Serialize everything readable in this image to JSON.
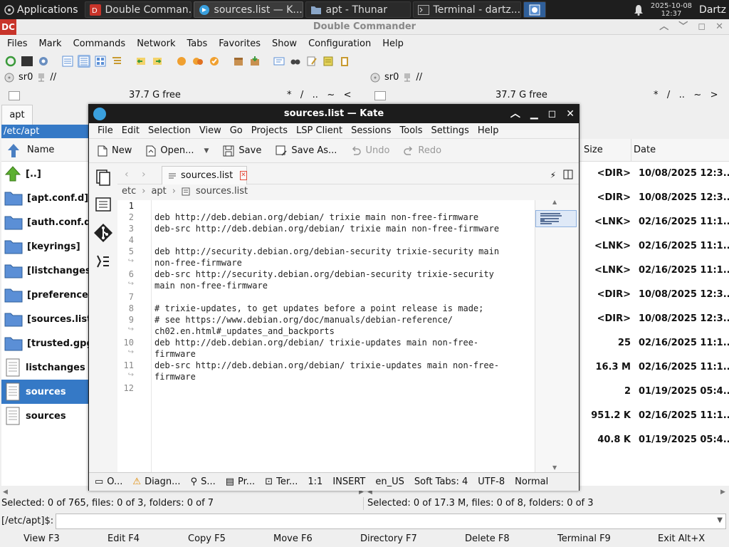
{
  "taskbar": {
    "apps_label": "Applications",
    "tasks": [
      {
        "label": "Double Comman...",
        "icon": "doublecmd-icon"
      },
      {
        "label": "sources.list  — K...",
        "icon": "kate-icon"
      },
      {
        "label": "apt - Thunar",
        "icon": "folder-icon"
      },
      {
        "label": "Terminal - dartz...",
        "icon": "terminal-icon"
      }
    ],
    "clock_date": "2025-10-08",
    "clock_time": "12:37",
    "user": "Dartz"
  },
  "dc": {
    "title": "Double Commander",
    "menu": [
      "Files",
      "Mark",
      "Commands",
      "Network",
      "Tabs",
      "Favorites",
      "Show",
      "Configuration",
      "Help"
    ],
    "drive_left": "sr0",
    "drive_left_path": "//",
    "drive_right": "sr0",
    "drive_right_path": "//",
    "free_left": "37.7 G free",
    "free_right": "37.7 G free",
    "nav_left": "*   /   ..   ~   <",
    "nav_right": "*   /   ..   ~   >",
    "tab_left": "apt",
    "path_left": "/etc/apt",
    "col_name": "Name",
    "col_size": "Size",
    "col_date": "Date",
    "files_left": [
      "[..]",
      "[apt.conf.d]",
      "[auth.conf.d]",
      "[keyrings]",
      "[listchanges...",
      "[preferences...",
      "[sources.list...",
      "[trusted.gpg...",
      "listchanges",
      "sources",
      "sources"
    ],
    "files_right": [
      {
        "size": "<DIR>",
        "date": "10/08/2025 12:3..."
      },
      {
        "size": "<DIR>",
        "date": "10/08/2025 12:3..."
      },
      {
        "size": "<LNK>",
        "date": "02/16/2025 11:1..."
      },
      {
        "size": "<LNK>",
        "date": "02/16/2025 11:1..."
      },
      {
        "size": "<LNK>",
        "date": "02/16/2025 11:1..."
      },
      {
        "size": "<DIR>",
        "date": "10/08/2025 12:3..."
      },
      {
        "size": "<DIR>",
        "date": "10/08/2025 12:3..."
      },
      {
        "size": "25",
        "date": "02/16/2025 11:1..."
      },
      {
        "size": "16.3 M",
        "date": "02/16/2025 11:1..."
      },
      {
        "size": "2",
        "date": "01/19/2025 05:4..."
      },
      {
        "size": "951.2 K",
        "date": "02/16/2025 11:1..."
      },
      {
        "size": "40.8 K",
        "date": "01/19/2025 05:4..."
      }
    ],
    "status_left": "Selected: 0 of 765, files: 0 of 3, folders: 0 of 7",
    "status_right": "Selected: 0 of 17.3 M, files: 0 of 8, folders: 0 of 3",
    "cmd_prompt": "[/etc/apt]$:",
    "fkeys": [
      "View F3",
      "Edit F4",
      "Copy F5",
      "Move F6",
      "Directory F7",
      "Delete F8",
      "Terminal F9",
      "Exit Alt+X"
    ]
  },
  "kate": {
    "title": "sources.list  — Kate",
    "menu": [
      "File",
      "Edit",
      "Selection",
      "View",
      "Go",
      "Projects",
      "LSP Client",
      "Sessions",
      "Tools",
      "Settings",
      "Help"
    ],
    "tool_new": "New",
    "tool_open": "Open...",
    "tool_save": "Save",
    "tool_saveas": "Save As...",
    "tool_undo": "Undo",
    "tool_redo": "Redo",
    "tab_name": "sources.list",
    "bread_1": "etc",
    "bread_2": "apt",
    "bread_3": "sources.list",
    "lines": [
      {
        "n": "1",
        "text": ""
      },
      {
        "n": "2",
        "text": "deb http://deb.debian.org/debian/ trixie main non-free-firmware"
      },
      {
        "n": "3",
        "text": "deb-src http://deb.debian.org/debian/ trixie main non-free-firmware"
      },
      {
        "n": "4",
        "text": ""
      },
      {
        "n": "5",
        "text": "deb http://security.debian.org/debian-security trixie-security main"
      },
      {
        "n": "",
        "text": "non-free-firmware"
      },
      {
        "n": "6",
        "text": "deb-src http://security.debian.org/debian-security trixie-security"
      },
      {
        "n": "",
        "text": "main non-free-firmware"
      },
      {
        "n": "7",
        "text": ""
      },
      {
        "n": "8",
        "text": "# trixie-updates, to get updates before a point release is made;"
      },
      {
        "n": "9",
        "text": "# see https://www.debian.org/doc/manuals/debian-reference/"
      },
      {
        "n": "",
        "text": "ch02.en.html#_updates_and_backports"
      },
      {
        "n": "10",
        "text": "deb http://deb.debian.org/debian/ trixie-updates main non-free-"
      },
      {
        "n": "",
        "text": "firmware"
      },
      {
        "n": "11",
        "text": "deb-src http://deb.debian.org/debian/ trixie-updates main non-free-"
      },
      {
        "n": "",
        "text": "firmware"
      },
      {
        "n": "12",
        "text": ""
      }
    ],
    "status": {
      "output": "O...",
      "diagnostics": "Diagn...",
      "search": "S...",
      "projects": "Pr...",
      "terminal": "Ter...",
      "cursor": "1:1",
      "mode": "INSERT",
      "lang": "en_US",
      "tabs": "Soft Tabs: 4",
      "encoding": "UTF-8",
      "highlight": "Normal"
    }
  },
  "colors": {
    "selection": "#3579c6",
    "taskbar": "#1e1e1e",
    "kate_title": "#1c1c1c",
    "folder": "#5b8fd6",
    "dc_logo": "#c8342a"
  }
}
